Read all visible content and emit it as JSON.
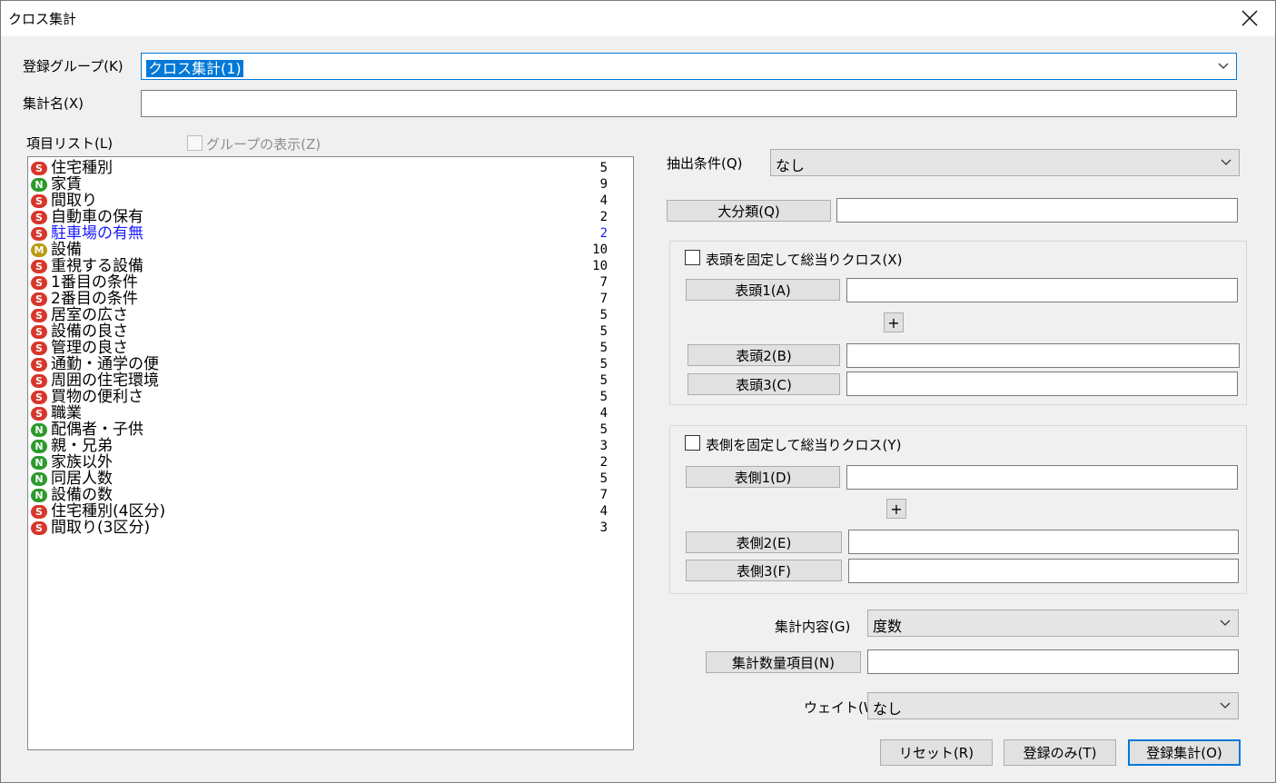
{
  "window": {
    "title": "クロス集計",
    "close_icon": "close-icon"
  },
  "group": {
    "label": "登録グループ(K)",
    "value": "クロス集計(1)"
  },
  "name": {
    "label": "集計名(X)",
    "value": ""
  },
  "item_list": {
    "label": "項目リスト(L)",
    "show_group_label": "グループの表示(Z)",
    "items": [
      {
        "type": "S",
        "name": "住宅種別",
        "count": "5"
      },
      {
        "type": "N",
        "name": "家賃",
        "count": "9"
      },
      {
        "type": "S",
        "name": "間取り",
        "count": "4"
      },
      {
        "type": "S",
        "name": "自動車の保有",
        "count": "2"
      },
      {
        "type": "S",
        "name": "駐車場の有無",
        "count": "2",
        "selected": true
      },
      {
        "type": "M",
        "name": "設備",
        "count": "10"
      },
      {
        "type": "S",
        "name": "重視する設備",
        "count": "10"
      },
      {
        "type": "S",
        "name": "1番目の条件",
        "count": "7"
      },
      {
        "type": "S",
        "name": "2番目の条件",
        "count": "7"
      },
      {
        "type": "S",
        "name": "居室の広さ",
        "count": "5"
      },
      {
        "type": "S",
        "name": "設備の良さ",
        "count": "5"
      },
      {
        "type": "S",
        "name": "管理の良さ",
        "count": "5"
      },
      {
        "type": "S",
        "name": "通勤・通学の便",
        "count": "5"
      },
      {
        "type": "S",
        "name": "周囲の住宅環境",
        "count": "5"
      },
      {
        "type": "S",
        "name": "買物の便利さ",
        "count": "5"
      },
      {
        "type": "S",
        "name": "職業",
        "count": "4"
      },
      {
        "type": "N",
        "name": "配偶者・子供",
        "count": "5"
      },
      {
        "type": "N",
        "name": "親・兄弟",
        "count": "3"
      },
      {
        "type": "N",
        "name": "家族以外",
        "count": "2"
      },
      {
        "type": "N",
        "name": "同居人数",
        "count": "5"
      },
      {
        "type": "N",
        "name": "設備の数",
        "count": "7"
      },
      {
        "type": "S",
        "name": "住宅種別(4区分)",
        "count": "4"
      },
      {
        "type": "S",
        "name": "間取り(3区分)",
        "count": "3"
      }
    ]
  },
  "extract": {
    "label": "抽出条件(Q)",
    "value": "なし"
  },
  "major": {
    "button": "大分類(Q)",
    "value": ""
  },
  "head_cross": {
    "checkbox_label": "表頭を固定して総当りクロス(X)",
    "b1": "表頭1(A)",
    "b2": "表頭2(B)",
    "b3": "表頭3(C)",
    "plus": "+"
  },
  "side_cross": {
    "checkbox_label": "表側を固定して総当りクロス(Y)",
    "b1": "表側1(D)",
    "b2": "表側2(E)",
    "b3": "表側3(F)",
    "plus": "+"
  },
  "content": {
    "label": "集計内容(G)",
    "value": "度数"
  },
  "quantity": {
    "button": "集計数量項目(N)",
    "value": ""
  },
  "weight": {
    "label": "ウェイト(W)",
    "value": "なし"
  },
  "footer": {
    "reset": "リセット(R)",
    "register_only": "登録のみ(T)",
    "register_aggregate": "登録集計(O)"
  }
}
